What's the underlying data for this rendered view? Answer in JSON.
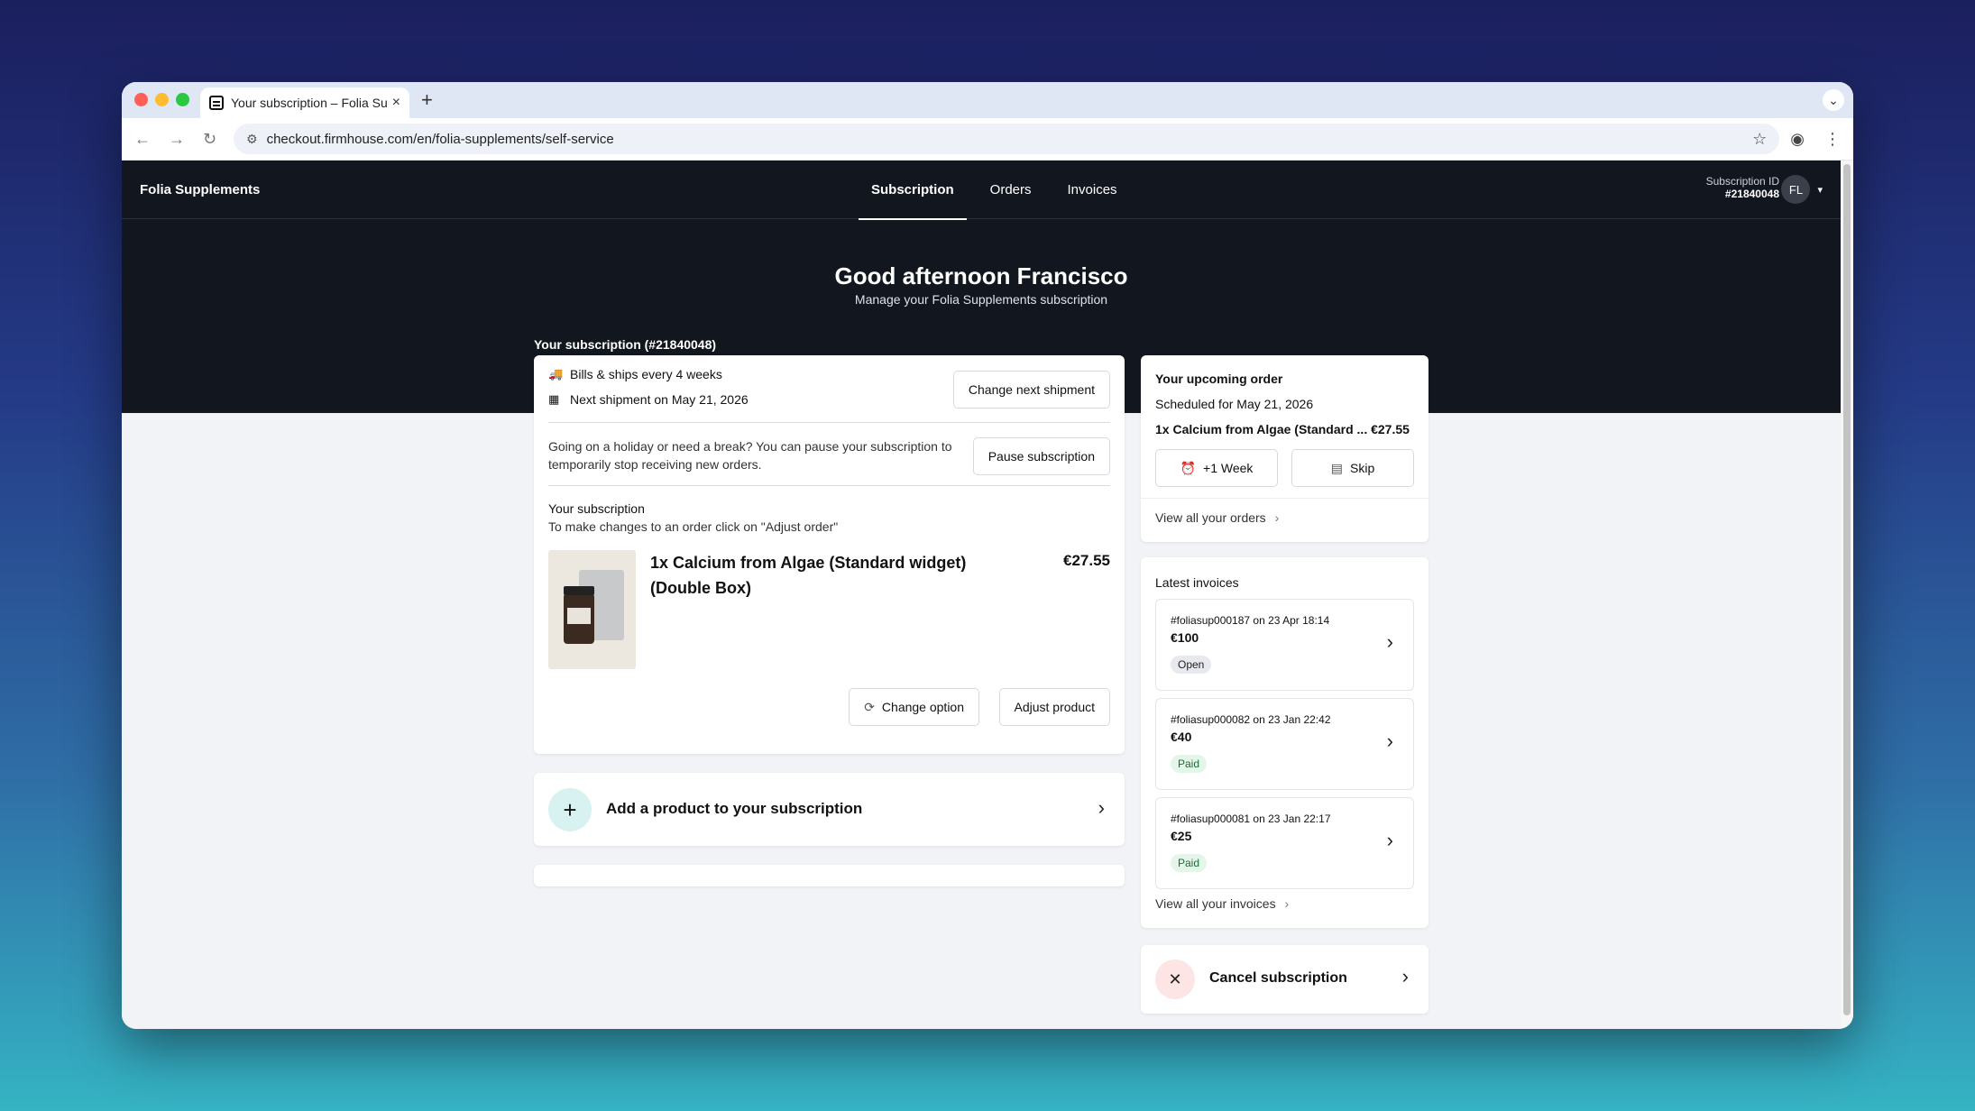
{
  "browser": {
    "tab_title": "Your subscription – Folia Sup",
    "tab_close": "×",
    "new_tab": "+",
    "url": "checkout.firmhouse.com/en/folia-supplements/self-service"
  },
  "app": {
    "brand": "Folia Supplements",
    "nav": [
      {
        "label": "Subscription",
        "active": true
      },
      {
        "label": "Orders"
      },
      {
        "label": "Invoices"
      }
    ],
    "subscription_id_label": "Subscription ID",
    "subscription_id_value": "#21840048",
    "avatar_initials": "FL"
  },
  "hero": {
    "greeting": "Good afternoon Francisco",
    "subtitle": "Manage your Folia Supplements subscription"
  },
  "subscription": {
    "section_title": "Your subscription (#21840048)",
    "billing": "Bills & ships every 4 weeks",
    "next_shipment": "Next shipment on May 21, 2026",
    "change_next_shipment": "Change next shipment",
    "pause_text": "Going on a holiday or need a break? You can pause your subscription to temporarily stop receiving new orders.",
    "pause_button": "Pause subscription",
    "products_title": "Your subscription",
    "products_hint": "To make changes to an order click on \"Adjust order\"",
    "product_name": "1x Calcium from Algae (Standard widget) (Double Box)",
    "product_price": "€27.55",
    "change_option": "Change option",
    "adjust_product": "Adjust product",
    "add_product": "Add a product to your subscription"
  },
  "upcoming": {
    "title": "Your upcoming order",
    "scheduled": "Scheduled for May 21, 2026",
    "product": "1x Calcium from Algae (Standard ... €27.55",
    "plus_week": "+1 Week",
    "skip": "Skip",
    "view_all": "View all your orders"
  },
  "invoices": {
    "title": "Latest invoices",
    "items": [
      {
        "ref": "#foliasup000187 on 23 Apr 18:14",
        "amount": "€100",
        "status": "Open"
      },
      {
        "ref": "#foliasup000082 on 23 Jan 22:42",
        "amount": "€40",
        "status": "Paid"
      },
      {
        "ref": "#foliasup000081 on 23 Jan 22:17",
        "amount": "€25",
        "status": "Paid"
      }
    ],
    "view_all": "View all your invoices"
  },
  "cancel": {
    "label": "Cancel subscription"
  },
  "icons": {
    "truck": "truck-icon",
    "calendar": "calendar-icon",
    "refresh": "refresh-icon",
    "alarm": "alarm-clock-icon",
    "skip": "calendar-skip-icon",
    "chevron": "chevron-right-icon",
    "plus": "plus-icon",
    "close": "close-icon"
  },
  "colors": {
    "hero_bg": "#12161f",
    "page_bg": "#f1f3f7",
    "add_circle": "#d8f2f2",
    "cancel_circle": "#fde5e5",
    "paid_badge": "#e4f6ea",
    "open_badge": "#e7e9ee"
  }
}
